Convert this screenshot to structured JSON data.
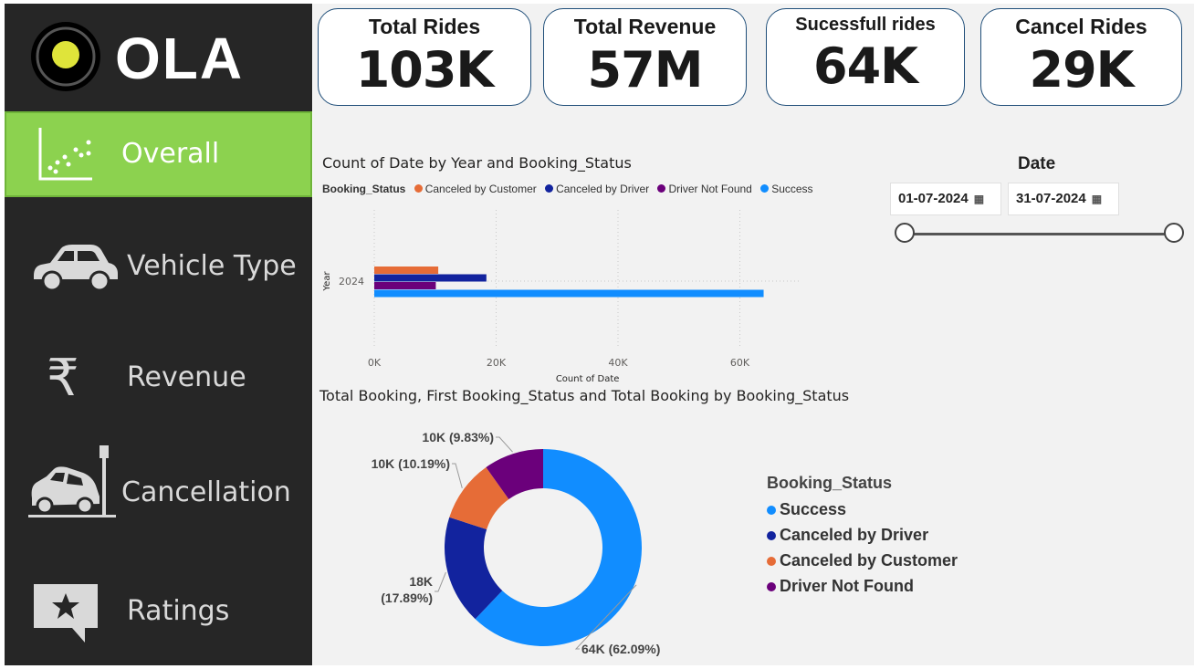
{
  "brand": {
    "name": "OLA"
  },
  "nav": [
    {
      "label": "Overall",
      "icon": "scatter-chart-icon",
      "active": true
    },
    {
      "label": "Vehicle Type",
      "icon": "car-icon",
      "active": false
    },
    {
      "label": "Revenue",
      "icon": "rupee-icon",
      "active": false
    },
    {
      "label": "Cancellation",
      "icon": "car-crash-icon",
      "active": false
    },
    {
      "label": "Ratings",
      "icon": "star-chat-icon",
      "active": false
    }
  ],
  "kpis": [
    {
      "title": "Total Rides",
      "value": "103K"
    },
    {
      "title": "Total Revenue",
      "value": "57M"
    },
    {
      "title": "Sucessfull rides",
      "value": "64K"
    },
    {
      "title": "Cancel Rides",
      "value": "29K"
    }
  ],
  "date_filter": {
    "title": "Date",
    "start": "01-07-2024",
    "end": "31-07-2024"
  },
  "colors": {
    "canceled_by_customer": "#e66c37",
    "canceled_by_driver": "#12239e",
    "driver_not_found": "#6b007b",
    "success": "#118dff",
    "active_nav": "#8cd24f",
    "sidebar": "#262626"
  },
  "chart_data": [
    {
      "type": "bar",
      "orientation": "horizontal",
      "title": "Count of Date by Year and Booking_Status",
      "legend_title": "Booking_Status",
      "xlabel": "Count of Date",
      "ylabel": "Year",
      "categories": [
        "2024"
      ],
      "series": [
        {
          "name": "Canceled by Customer",
          "values": [
            10500
          ]
        },
        {
          "name": "Canceled by Driver",
          "values": [
            18400
          ]
        },
        {
          "name": "Driver Not Found",
          "values": [
            10100
          ]
        },
        {
          "name": "Success",
          "values": [
            63900
          ]
        }
      ],
      "xlim": [
        0,
        70000
      ],
      "xticks": [
        "0K",
        "20K",
        "40K",
        "60K"
      ],
      "grid": true
    },
    {
      "type": "pie",
      "variant": "donut",
      "title": "Total Booking, First Booking_Status and Total Booking by Booking_Status",
      "legend_title": "Booking_Status",
      "slices": [
        {
          "name": "Success",
          "value": 62.09,
          "label": "64K (62.09%)"
        },
        {
          "name": "Canceled by Driver",
          "value": 17.89,
          "label_line1": "18K",
          "label_line2": "(17.89%)"
        },
        {
          "name": "Canceled by Customer",
          "value": 10.19,
          "label": "10K (10.19%)"
        },
        {
          "name": "Driver Not Found",
          "value": 9.83,
          "label": "10K (9.83%)"
        }
      ],
      "legend": [
        "Success",
        "Canceled by Driver",
        "Canceled by Customer",
        "Driver Not Found"
      ]
    }
  ]
}
